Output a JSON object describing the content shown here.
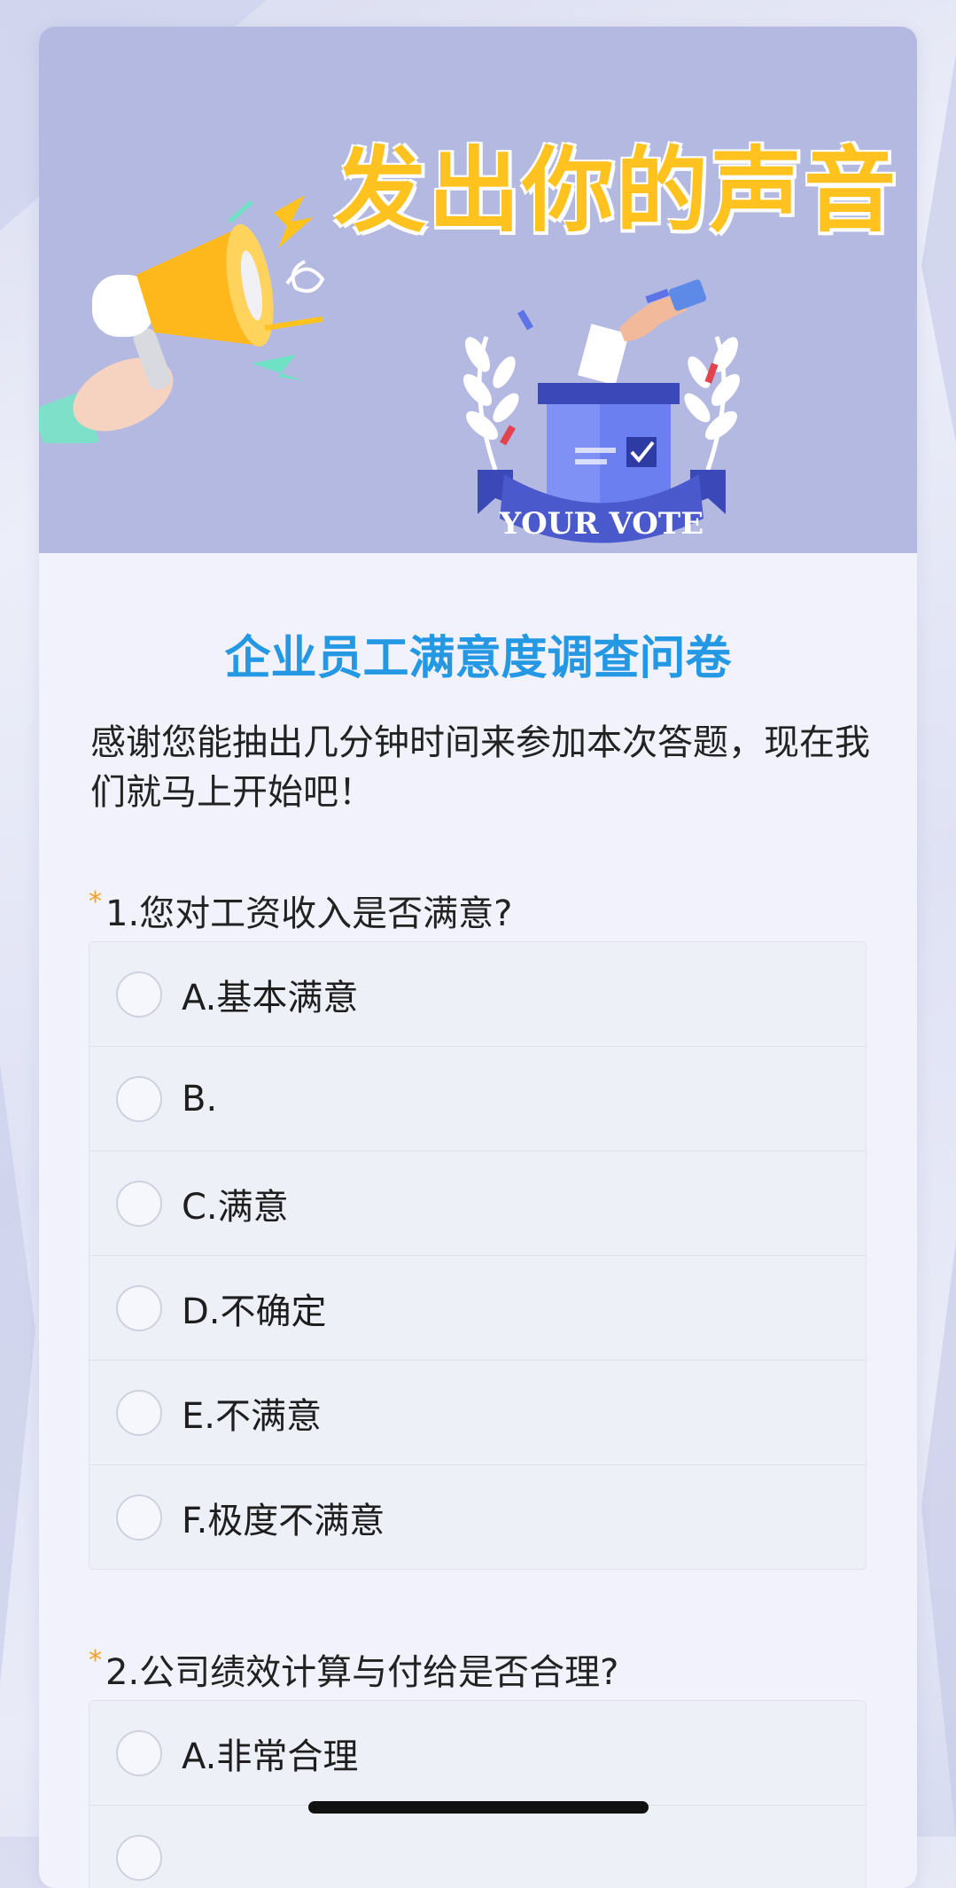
{
  "banner": {
    "headline": "发出你的声音",
    "ribbon_text": "YOUR VOTE"
  },
  "survey": {
    "title": "企业员工满意度调查问卷",
    "intro": "感谢您能抽出几分钟时间来参加本次答题，现在我们就马上开始吧！",
    "required_mark": "*"
  },
  "questions": [
    {
      "title": "1.您对工资收入是否满意?",
      "options": [
        "A.基本满意",
        "B.",
        "C.满意",
        "D.不确定",
        "E.不满意",
        "F.极度不满意"
      ]
    },
    {
      "title": "2.公司绩效计算与付给是否合理?",
      "options": [
        "A.非常合理",
        ""
      ]
    }
  ],
  "colors": {
    "title_blue": "#2598e3",
    "required_star": "#f0a21b",
    "banner_bg": "#b4b9e2",
    "headline_yellow": "#ffc21f"
  },
  "icons": [
    "megaphone-icon",
    "ballot-box-icon",
    "laurel-icon",
    "checkmark-icon",
    "lightning-icon"
  ]
}
